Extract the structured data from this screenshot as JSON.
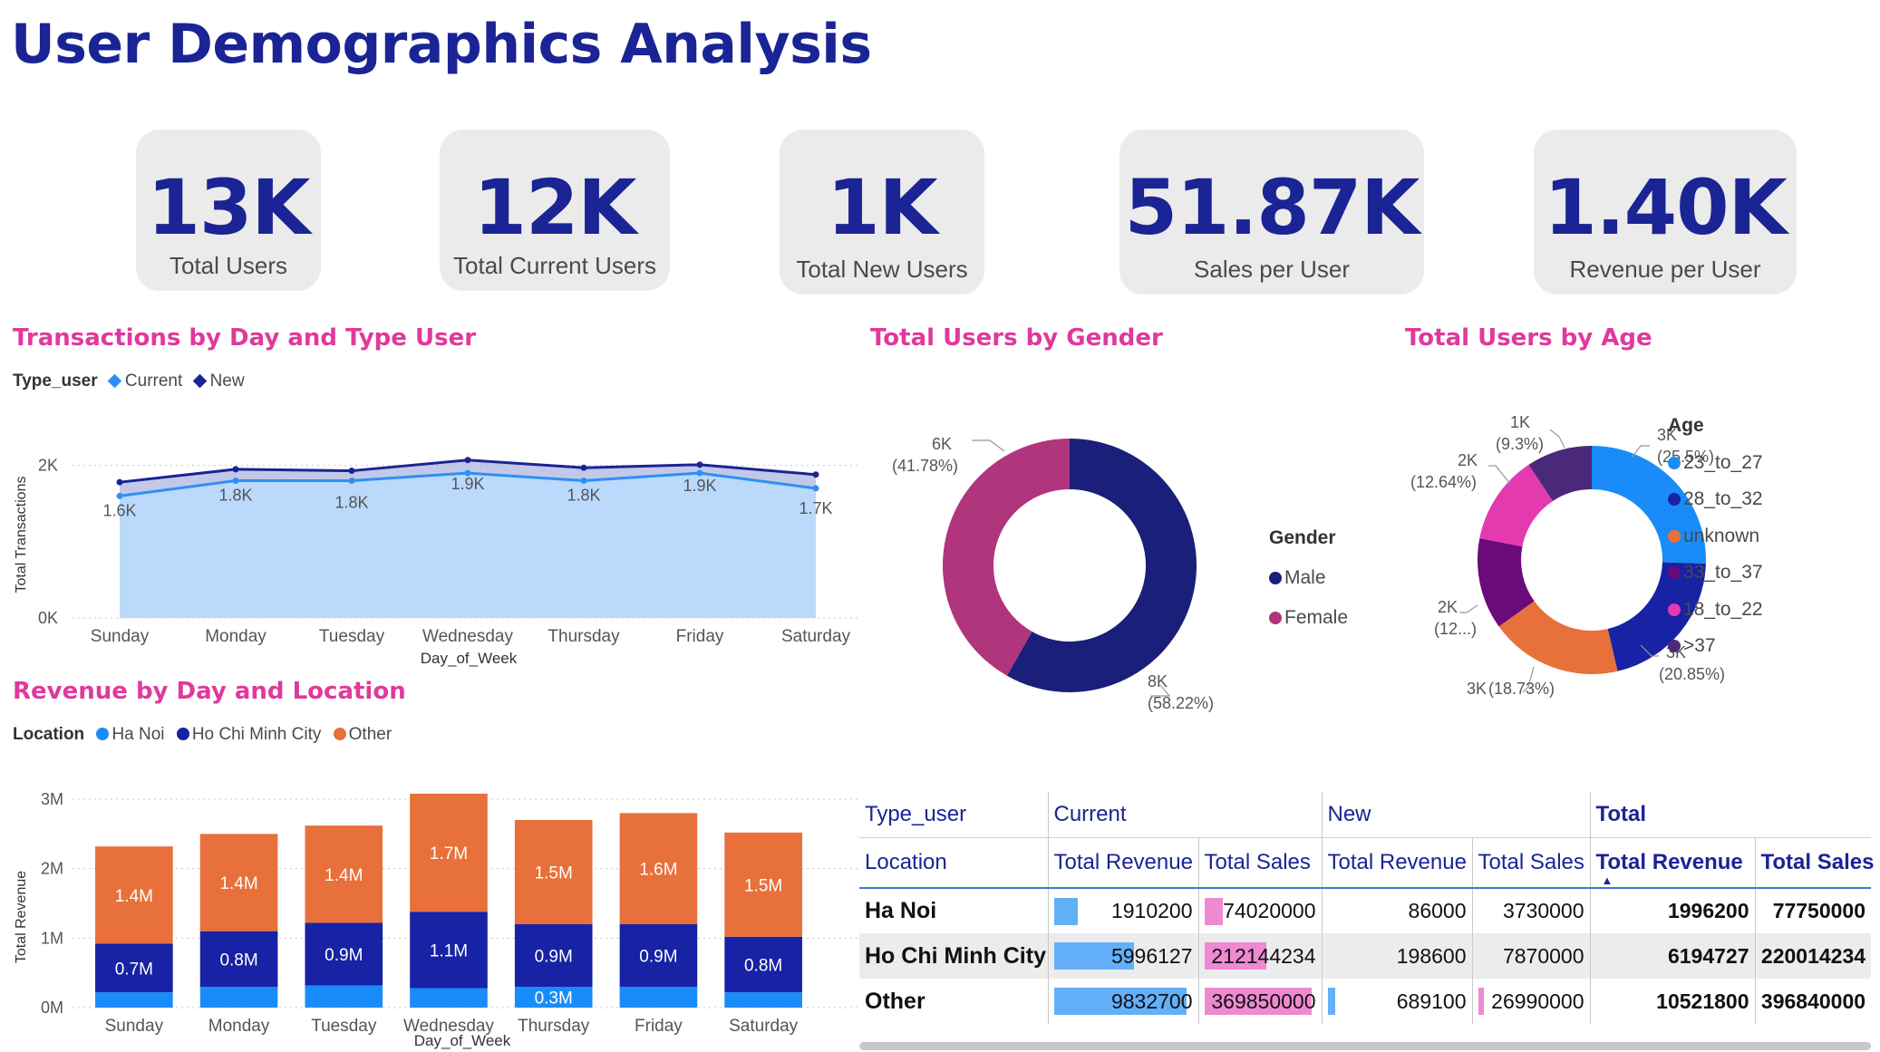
{
  "page": {
    "title": "User Demographics Analysis"
  },
  "kpis": [
    {
      "value": "13K",
      "label": "Total Users"
    },
    {
      "value": "12K",
      "label": "Total Current Users"
    },
    {
      "value": "1K",
      "label": "Total New Users"
    },
    {
      "value": "51.87K",
      "label": "Sales per User"
    },
    {
      "value": "1.40K",
      "label": "Revenue per User"
    }
  ],
  "colors": {
    "title_blue": "#1a2494",
    "section_pink": "#e0399b",
    "current_line": "#2f8ff5",
    "new_line": "#1a2494",
    "area_fill": "#bad9fb",
    "ha_noi": "#1a8cf9",
    "hcm": "#1722a4",
    "other": "#e8703a"
  },
  "transactions_chart": {
    "title": "Transactions by Day and Type User",
    "legend_title": "Type_user",
    "legend": [
      "Current",
      "New"
    ],
    "xlabel": "Day_of_Week",
    "ylabel": "Total Transactions",
    "y_ticks": [
      "0K",
      "2K"
    ]
  },
  "gender_chart": {
    "title": "Total Users by Gender",
    "legend_title": "Gender",
    "legend": [
      "Male",
      "Female"
    ],
    "labels": [
      {
        "value": "8K",
        "pct": "(58.22%)"
      },
      {
        "value": "6K",
        "pct": "(41.78%)"
      }
    ]
  },
  "age_chart": {
    "title": "Total Users by Age",
    "legend_title": "Age",
    "legend": [
      "23_to_27",
      "28_to_32",
      "unknown",
      "33_to_37",
      "18_to_22",
      ">37"
    ],
    "labels": {
      "a2327": {
        "value": "3K",
        "pct": "(25.5%)"
      },
      "a2832": {
        "value": "3K",
        "pct": "(20.85%)"
      },
      "unknown": {
        "value": "3K",
        "pct": "(18.73%)"
      },
      "a3337": {
        "value": "2K",
        "pct": "(12...)"
      },
      "a1822": {
        "value": "2K",
        "pct": "(12.64%)"
      },
      "a37": {
        "value": "1K",
        "pct": "(9.3%)"
      }
    }
  },
  "revenue_chart": {
    "title": "Revenue by Day and Location",
    "legend_title": "Location",
    "legend": [
      "Ha Noi",
      "Ho Chi Minh City",
      "Other"
    ],
    "xlabel": "Day_of_Week",
    "ylabel": "Total Revenue",
    "y_ticks": [
      "0M",
      "1M",
      "2M",
      "3M"
    ]
  },
  "chart_data": [
    {
      "type": "area",
      "title": "Transactions by Day and Type User",
      "xlabel": "Day_of_Week",
      "ylabel": "Total Transactions",
      "categories": [
        "Sunday",
        "Monday",
        "Tuesday",
        "Wednesday",
        "Thursday",
        "Friday",
        "Saturday"
      ],
      "series": [
        {
          "name": "Current",
          "values": [
            1600,
            1800,
            1800,
            1900,
            1800,
            1900,
            1700
          ],
          "labels": [
            "1.6K",
            "1.8K",
            "1.8K",
            "1.9K",
            "1.8K",
            "1.9K",
            "1.7K"
          ]
        },
        {
          "name": "New",
          "values": [
            1780,
            1950,
            1930,
            2070,
            1970,
            2010,
            1880
          ]
        }
      ],
      "ylim": [
        0,
        2000
      ],
      "stacked": false,
      "grid": true,
      "legend_position": "top-left"
    },
    {
      "type": "pie",
      "title": "Total Users by Gender",
      "donut": true,
      "categories": [
        "Male",
        "Female"
      ],
      "values": [
        58.22,
        41.78
      ],
      "legend_position": "right"
    },
    {
      "type": "pie",
      "title": "Total Users by Age",
      "donut": true,
      "categories": [
        "23_to_27",
        "28_to_32",
        "unknown",
        "33_to_37",
        "18_to_22",
        ">37"
      ],
      "values": [
        25.5,
        20.85,
        18.73,
        12.94,
        12.64,
        9.3
      ],
      "legend_position": "right"
    },
    {
      "type": "bar",
      "stacked": true,
      "title": "Revenue by Day and Location",
      "xlabel": "Day_of_Week",
      "ylabel": "Total Revenue",
      "categories": [
        "Sunday",
        "Monday",
        "Tuesday",
        "Wednesday",
        "Thursday",
        "Friday",
        "Saturday"
      ],
      "series": [
        {
          "name": "Ha Noi",
          "values": [
            0.22,
            0.3,
            0.32,
            0.28,
            0.3,
            0.3,
            0.22
          ],
          "labels": [
            "",
            "",
            "",
            "",
            "0.3M",
            "",
            ""
          ]
        },
        {
          "name": "Ho Chi Minh City",
          "values": [
            0.7,
            0.8,
            0.9,
            1.1,
            0.9,
            0.9,
            0.8
          ],
          "labels": [
            "0.7M",
            "0.8M",
            "0.9M",
            "1.1M",
            "0.9M",
            "0.9M",
            "0.8M"
          ]
        },
        {
          "name": "Other",
          "values": [
            1.4,
            1.4,
            1.4,
            1.7,
            1.5,
            1.6,
            1.5
          ],
          "labels": [
            "1.4M",
            "1.4M",
            "1.4M",
            "1.7M",
            "1.5M",
            "1.6M",
            "1.5M"
          ]
        }
      ],
      "ylim": [
        0,
        3
      ],
      "y_unit": "M",
      "grid": true,
      "legend_position": "top-left"
    }
  ],
  "matrix": {
    "row1": {
      "type_user": "Type_user",
      "current": "Current",
      "new": "New",
      "total": "Total"
    },
    "row2": {
      "location": "Location",
      "cur_rev": "Total Revenue",
      "cur_sales": "Total Sales",
      "new_rev": "Total Revenue",
      "new_sales": "Total Sales",
      "tot_rev": "Total Revenue",
      "tot_sales": "Total Sales",
      "sort_glyph": "▲"
    },
    "rows": [
      {
        "location": "Ha Noi",
        "cur_rev": "1910200",
        "cur_sales": "74020000",
        "new_rev": "86000",
        "new_sales": "3730000",
        "tot_rev": "1996200",
        "tot_sales": "77750000"
      },
      {
        "location": "Ho Chi Minh City",
        "cur_rev": "5996127",
        "cur_sales": "212144234",
        "new_rev": "198600",
        "new_sales": "7870000",
        "tot_rev": "6194727",
        "tot_sales": "220014234"
      },
      {
        "location": "Other",
        "cur_rev": "9832700",
        "cur_sales": "369850000",
        "new_rev": "689100",
        "new_sales": "26990000",
        "tot_rev": "10521800",
        "tot_sales": "396840000"
      }
    ]
  }
}
